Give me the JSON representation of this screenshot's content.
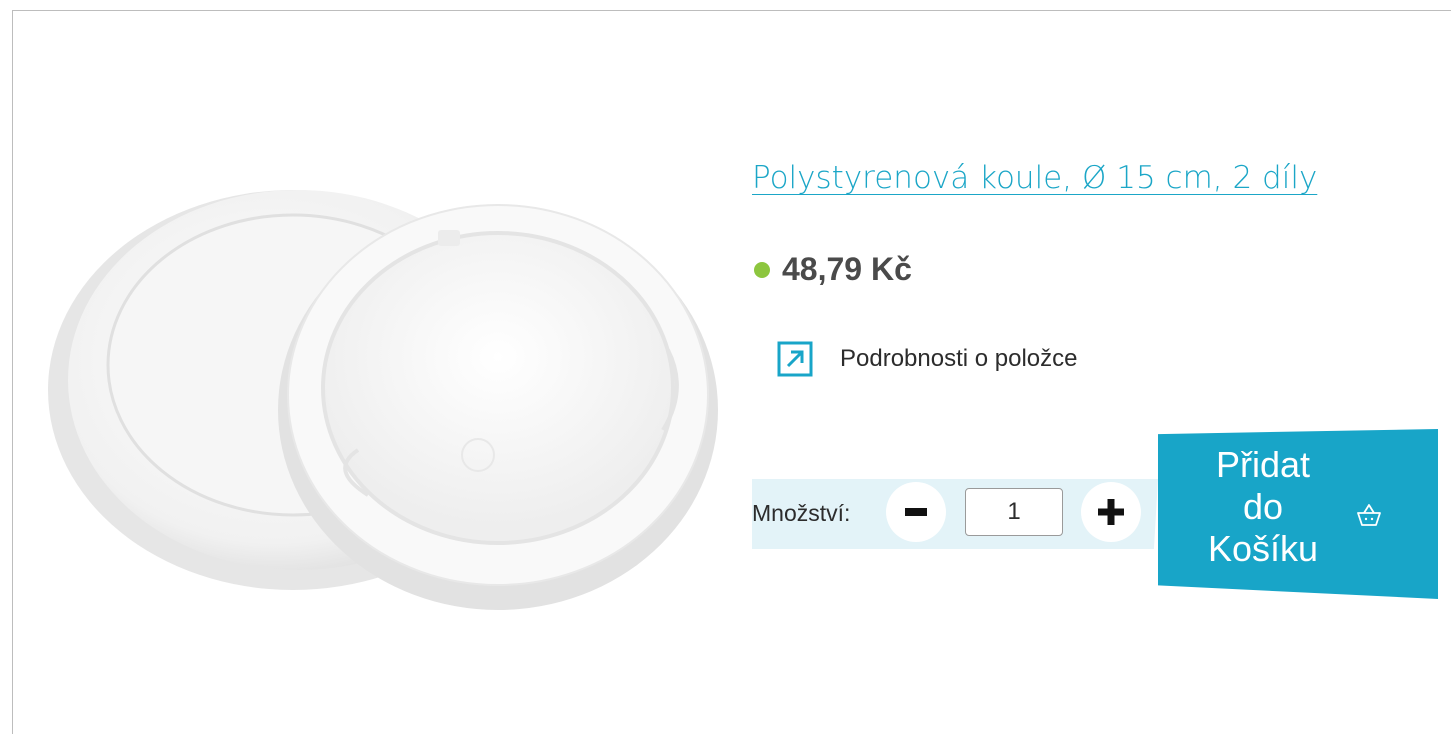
{
  "product": {
    "title": "Polystyrenová koule, Ø 15 cm, 2 díly",
    "price": "48,79 Kč",
    "stock_color": "#8dc63f",
    "accent_color": "#18a5c8",
    "image_icon": "polystyrene-ball-halves-image"
  },
  "details": {
    "icon": "external-link-arrow-icon",
    "label": "Podrobnosti o položce"
  },
  "quantity": {
    "label": "Množství:",
    "value": "1",
    "minus_icon": "minus-icon",
    "plus_icon": "plus-icon"
  },
  "cart": {
    "line1": "Přidat",
    "line2": "do",
    "line3": "Košíku",
    "icon": "shopping-basket-icon"
  }
}
